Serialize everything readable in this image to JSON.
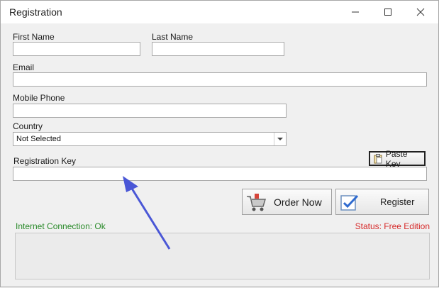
{
  "window": {
    "title": "Registration",
    "controls": {
      "minimize": "minimize",
      "maximize": "maximize",
      "close": "close"
    }
  },
  "form": {
    "first_name": {
      "label": "First Name",
      "value": ""
    },
    "last_name": {
      "label": "Last Name",
      "value": ""
    },
    "email": {
      "label": "Email",
      "value": ""
    },
    "mobile": {
      "label": "Mobile Phone",
      "value": ""
    },
    "country": {
      "label": "Country",
      "selected": "Not Selected"
    },
    "registration_key": {
      "label": "Registration Key",
      "value": ""
    }
  },
  "buttons": {
    "paste_key": "Paste Key",
    "order_now": "Order Now",
    "register": "Register"
  },
  "status": {
    "connection": "Internet Connection: Ok",
    "edition": "Status: Free Edition"
  },
  "colors": {
    "ok_green": "#2a8a2a",
    "status_red": "#d62b2b",
    "annotation_arrow": "#4a57d6"
  },
  "icons": {
    "paste": "clipboard-icon",
    "order": "shopping-cart-icon",
    "register": "checkmark-icon",
    "dropdown": "chevron-down-icon"
  }
}
